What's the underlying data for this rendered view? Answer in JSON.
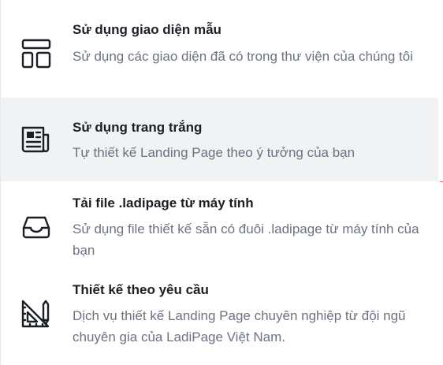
{
  "menu": {
    "items": [
      {
        "title": "Sử dụng giao diện mẫu",
        "description": "Sử dụng các giao diện đã có trong thư viện của chúng tôi",
        "icon": "layout-template-icon"
      },
      {
        "title": "Sử dụng trang trắng",
        "description": "Tự thiết kế Landing Page theo ý tưởng của bạn",
        "icon": "newspaper-icon"
      },
      {
        "title": "Tải file .ladipage từ máy tính",
        "description": "Sử dụng file thiết kế sẵn có đuôi .ladipage từ máy tính của bạn",
        "icon": "inbox-tray-icon"
      },
      {
        "title": "Thiết kế theo yêu cầu",
        "description": "Dịch vụ thiết kế Landing Page chuyên nghiệp từ đội ngũ chuyên gia của LadiPage Việt Nam.",
        "icon": "set-square-pencil-icon"
      }
    ]
  },
  "colors": {
    "title": "#1b1e24",
    "description": "#6b7280",
    "hover_background": "#f1f2f4",
    "icon": "#1b1e24"
  }
}
